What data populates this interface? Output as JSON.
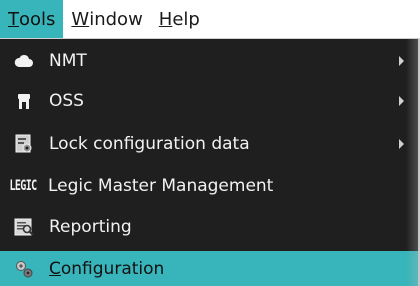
{
  "menubar": {
    "items": [
      {
        "mnemonic": "T",
        "rest": "ools"
      },
      {
        "mnemonic": "W",
        "rest": "indow"
      },
      {
        "mnemonic": "H",
        "rest": "elp"
      }
    ]
  },
  "menu": {
    "items": [
      {
        "label": "NMT",
        "icon": "cloud-icon",
        "has_submenu": true
      },
      {
        "label": "OSS",
        "icon": "lock-icon",
        "has_submenu": true
      },
      {
        "label": "Lock configuration data",
        "icon": "document-config-icon",
        "has_submenu": true
      },
      {
        "label": "Legic Master Management",
        "icon": "legic-icon",
        "icon_text": "LEGIC",
        "has_submenu": false
      },
      {
        "label": "Reporting",
        "icon": "report-icon",
        "has_submenu": false
      },
      {
        "mnemonic": "C",
        "rest": "onfiguration",
        "icon": "gears-icon",
        "has_submenu": false,
        "highlighted": true
      }
    ]
  },
  "colors": {
    "highlight": "#37b5bb",
    "menu_background": "#1f1f1f",
    "menubar_background": "#ffffff"
  }
}
